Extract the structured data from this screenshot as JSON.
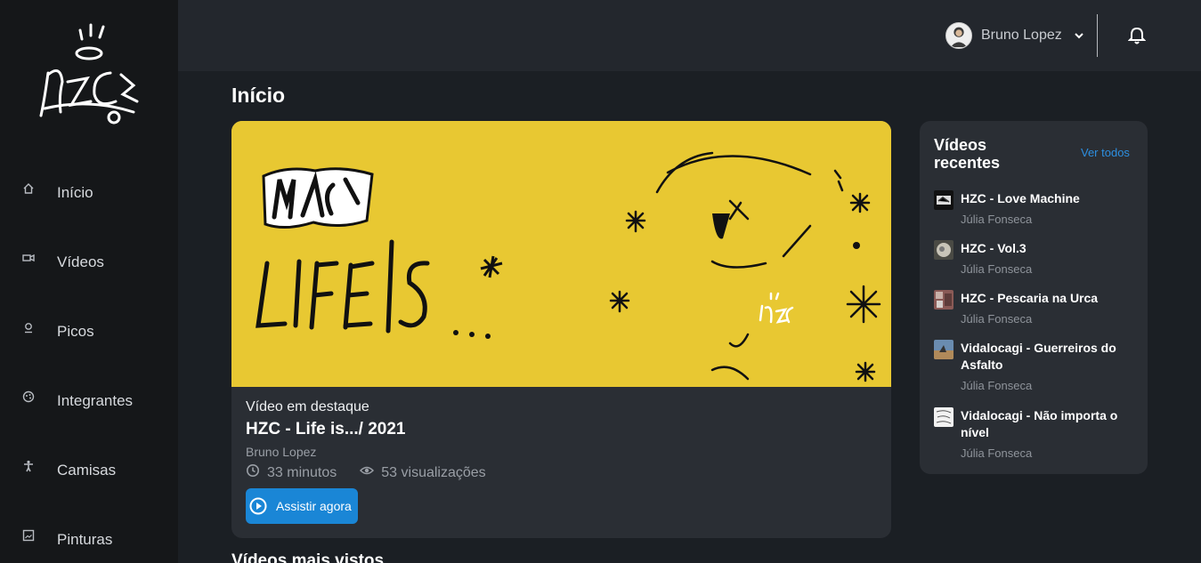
{
  "sidebar": {
    "logo_text": "HZC",
    "items": [
      {
        "label": "Início",
        "icon": "home-icon"
      },
      {
        "label": "Vídeos",
        "icon": "video-camera-icon"
      },
      {
        "label": "Picos",
        "icon": "map-pin-icon"
      },
      {
        "label": "Integrantes",
        "icon": "palette-icon"
      },
      {
        "label": "Camisas",
        "icon": "person-icon"
      },
      {
        "label": "Pinturas",
        "icon": "picture-frame-icon"
      }
    ]
  },
  "header": {
    "user_name": "Bruno Lopez",
    "avatar_icon": "user-avatar",
    "dropdown_icon": "chevron-down-icon",
    "notifications_icon": "bell-icon"
  },
  "main": {
    "page_title": "Início",
    "featured": {
      "kicker": "Vídeo em destaque",
      "title": "HZC - Life is.../ 2021",
      "author": "Bruno Lopez",
      "duration": "33 minutos",
      "views": "53 visualizações",
      "watch_label": "Assistir agora",
      "thumb_text": "LIFE IS ...",
      "thumb_color": "#e8c832"
    },
    "most_viewed_title": "Vídeos mais vistos"
  },
  "recent": {
    "title": "Vídeos recentes",
    "see_all": "Ver todos",
    "items": [
      {
        "title": "HZC - Love Machine",
        "author": "Júlia Fonseca"
      },
      {
        "title": "HZC - Vol.3",
        "author": "Júlia Fonseca"
      },
      {
        "title": "HZC - Pescaria na Urca",
        "author": "Júlia Fonseca"
      },
      {
        "title": "Vidalocagi - Guerreiros do Asfalto",
        "author": "Júlia Fonseca"
      },
      {
        "title": "Vidalocagi - Não importa o nível",
        "author": "Júlia Fonseca"
      }
    ]
  },
  "colors": {
    "accent": "#1a86d6",
    "link": "#2d8fe0",
    "sidebar_bg": "#151719",
    "card_bg": "#2a2e34"
  }
}
